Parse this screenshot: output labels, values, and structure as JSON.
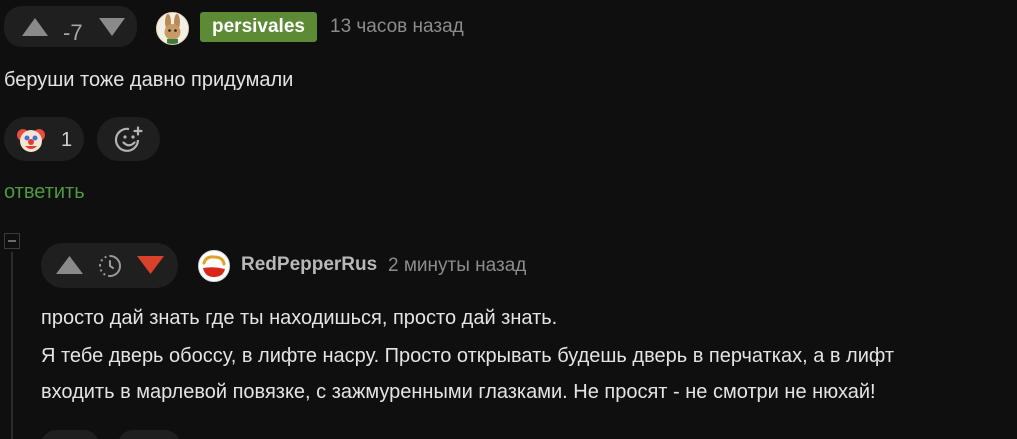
{
  "comment1": {
    "score": "-7",
    "username": "persivales",
    "time": "13 часов назад",
    "text": "беруши тоже давно придумали",
    "reaction": {
      "emoji": "clown-face-icon",
      "count": "1"
    },
    "reply_label": "ответить"
  },
  "comment2": {
    "username": "RedPepperRus",
    "time": "2 минуты назад",
    "text_lines": [
      "просто дай знать где ты находишься, просто дай знать.",
      "Я тебе дверь обоссу, в лифте насру. Просто открывать будешь дверь в перчатках, а в лифт",
      "входить в марлевой повязке, с зажмуренными глазками. Не просят - не смотри не нюхай!"
    ]
  },
  "colors": {
    "background": "#0f0f0f",
    "pill": "#1f1f1f",
    "username_badge": "#5c8a35",
    "reply_link": "#4c9a3c",
    "downvote_active": "#d9412b"
  }
}
